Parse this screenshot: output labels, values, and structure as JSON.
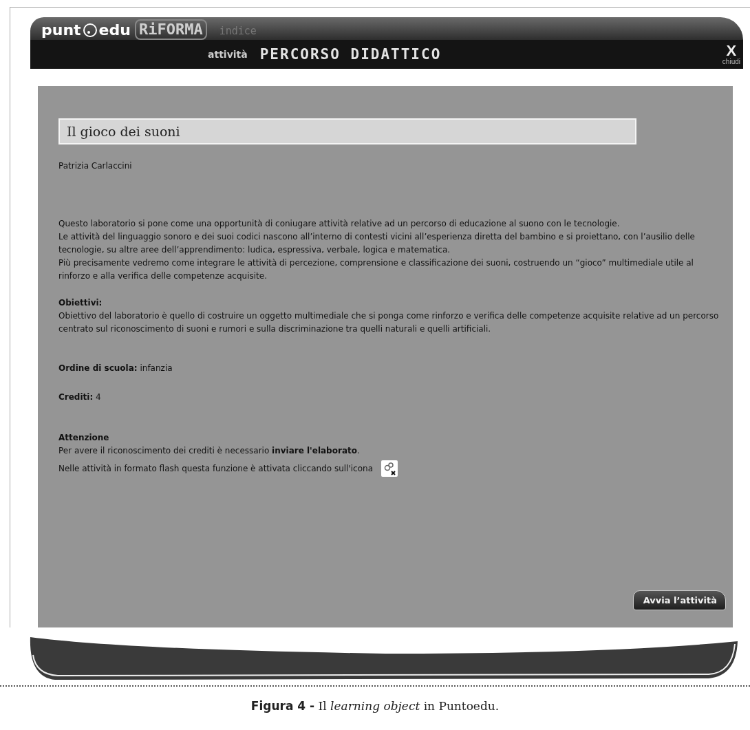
{
  "header": {
    "logo": {
      "part_1": "punt",
      "part_2": "edu",
      "part_3": "RiFORMA"
    },
    "index_link": "indice",
    "section_label": "attività",
    "section_title": "PERCORSO DIDATTICO",
    "close": {
      "glyph": "X",
      "label": "chiudi"
    }
  },
  "content": {
    "title": "Il gioco dei suoni",
    "author": "Patrizia Carlaccini",
    "intro": [
      "Questo laboratorio si pone come una opportunità di coniugare attività relative ad un percorso di educazione al suono con le tecnologie.",
      "Le attività del linguaggio sonoro e dei suoi codici nascono all’interno di contesti vicini all’esperienza diretta del bambino e si proiettano, con l’ausilio delle tecnologie, su altre aree dell’apprendimento: ludica, espressiva, verbale, logica e matematica.",
      "Più precisamente vedremo come integrare le attività di percezione, comprensione e classificazione dei suoni, costruendo un “gioco” multimediale utile al rinforzo e alla verifica delle competenze acquisite."
    ],
    "objectives": {
      "heading": "Obiettivi:",
      "text": "Obiettivo del laboratorio è quello di costruire un oggetto multimediale che si ponga come rinforzo e verifica delle competenze acquisite relative ad un percorso  centrato sul riconoscimento di suoni e rumori e sulla discriminazione tra quelli naturali e quelli artificiali."
    },
    "fields": [
      {
        "label": "Ordine di scuola:",
        "value": "infanzia"
      },
      {
        "label": "Crediti:",
        "value": "4"
      }
    ],
    "attention": {
      "heading": "Attenzione",
      "text": "Per avere il riconoscimento dei crediti è necessario **inviare l'elaborato**.",
      "icon_text": "Nelle attività in formato flash questa funzione è attivata cliccando sull'icona"
    },
    "start_button": "Avvia l’attività"
  },
  "caption": "**Figura 4 -** Il *learning object* in Puntoedu."
}
